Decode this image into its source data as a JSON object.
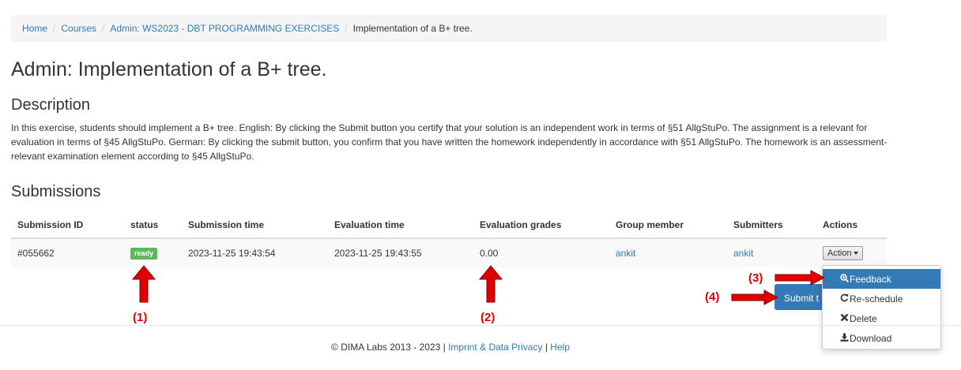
{
  "breadcrumb": {
    "items": [
      "Home",
      "Courses",
      "Admin: WS2023 - DBT PROGRAMMING EXERCISES"
    ],
    "active": "Implementation of a B+ tree."
  },
  "page_title": "Admin: Implementation of a B+ tree.",
  "description": {
    "heading": "Description",
    "text": "In this exercise, students should implement a B+ tree. English: By clicking the Submit button you certify that your solution is an independent work in terms of §51 AllgStuPo. The assignment is a relevant for evaluation in terms of §45 AllgStuPo. German: By clicking the submit button, you confirm that you have written the homework independently in accordance with §51 AllgStuPo. The homework is an assessment-relevant examination element according to §45 AllgStuPo."
  },
  "submissions": {
    "heading": "Submissions",
    "columns": [
      "Submission ID",
      "status",
      "Submission time",
      "Evaluation time",
      "Evaluation grades",
      "Group member",
      "Submitters",
      "Actions"
    ],
    "rows": [
      {
        "id": "#055662",
        "status": "ready",
        "submission_time": "2023-11-25 19:43:54",
        "evaluation_time": "2023-11-25 19:43:55",
        "grades": "0.00",
        "group_member": "ankit",
        "submitter": "ankit",
        "action_label": "Action"
      }
    ]
  },
  "submit_button": {
    "label": "Submit t"
  },
  "action_menu": {
    "items": [
      {
        "label": "Feedback",
        "icon": "search-plus-icon",
        "active": true
      },
      {
        "label": "Re-schedule",
        "icon": "refresh-icon",
        "active": false
      },
      {
        "label": "Delete",
        "icon": "times-icon",
        "active": false
      },
      {
        "label": "Download",
        "icon": "download-icon",
        "active": false
      }
    ]
  },
  "annotations": {
    "labels": [
      "(1)",
      "(2)",
      "(3)",
      "(4)"
    ],
    "color": "#e00000"
  },
  "footer": {
    "copyright": "© DIMA Labs 2013 - 2023 |",
    "imprint": "Imprint & Data Privacy",
    "separator": "|",
    "help": "Help"
  },
  "colors": {
    "link": "#337ab7",
    "primary": "#337ab7",
    "success": "#5cb85c",
    "breadcrumb_bg": "#f5f5f5"
  }
}
